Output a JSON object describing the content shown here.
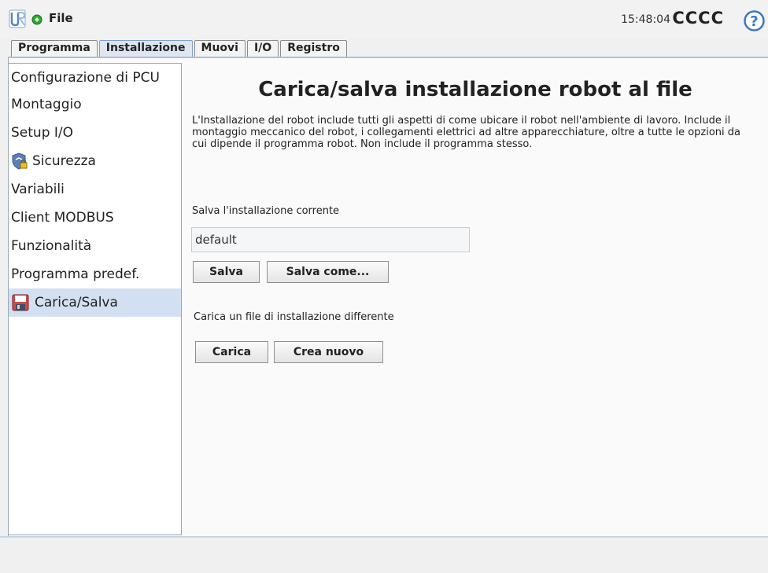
{
  "topbar": {
    "logo_icon": "ur-logo-icon",
    "status_icon": "status-green-icon",
    "status_color": "#2ea82e",
    "file_label": "File",
    "clock": "15:48:04",
    "robot_name": "CCCC",
    "help_icon": "help-icon",
    "help_color": "#3b78c4"
  },
  "tabs": [
    {
      "label": "Programma"
    },
    {
      "label": "Installazione",
      "active": true
    },
    {
      "label": "Muovi"
    },
    {
      "label": "I/O"
    },
    {
      "label": "Registro"
    }
  ],
  "sidebar": {
    "items": [
      {
        "label": "Configurazione di PCU"
      },
      {
        "label": "Montaggio"
      },
      {
        "label": "Setup I/O"
      },
      {
        "label": "Sicurezza",
        "icon": "shield-lock-icon"
      },
      {
        "label": "Variabili"
      },
      {
        "label": "Client MODBUS"
      },
      {
        "label": "Funzionalità"
      },
      {
        "label": "Programma predef."
      },
      {
        "label": "Carica/Salva",
        "icon": "floppy-disk-icon",
        "active": true
      }
    ]
  },
  "main": {
    "title": "Carica/salva installazione robot al file",
    "description": "L'Installazione del robot include tutti gli aspetti di come ubicare il robot nell'ambiente di lavoro. Include il montaggio meccanico del robot, i collegamenti elettrici ad altre apparecchiature, oltre a tutte le opzioni da cui dipende il programma robot. Non include il programma stesso.",
    "save_label": "Salva l'installazione corrente",
    "filename_value": "default",
    "save_button": "Salva",
    "save_as_button": "Salva come...",
    "load_label": "Carica un file di installazione differente",
    "load_button": "Carica",
    "new_button": "Crea nuovo"
  }
}
